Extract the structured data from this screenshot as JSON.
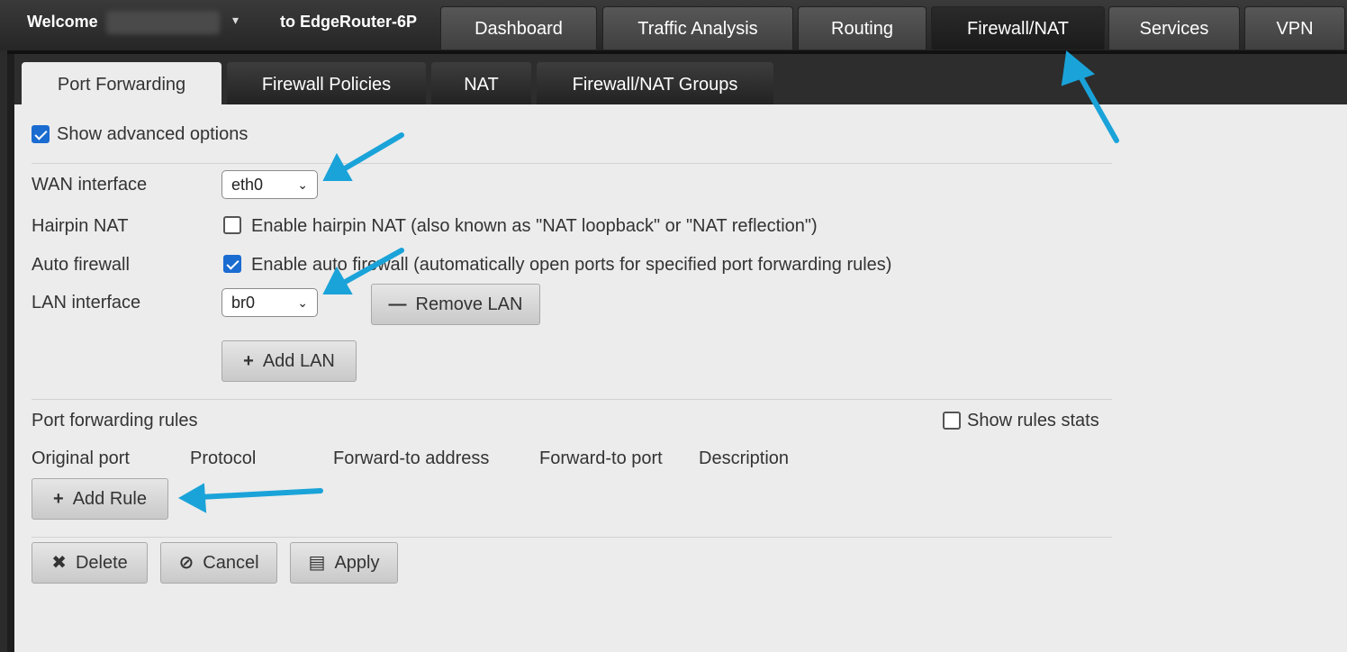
{
  "topbar": {
    "welcome": "Welcome",
    "caret": "▾",
    "router_name": "to EdgeRouter-6P",
    "tabs": [
      "Dashboard",
      "Traffic Analysis",
      "Routing",
      "Firewall/NAT",
      "Services",
      "VPN"
    ],
    "active_tab": "Firewall/NAT"
  },
  "subtabs": {
    "items": [
      "Port Forwarding",
      "Firewall Policies",
      "NAT",
      "Firewall/NAT Groups"
    ],
    "active": "Port Forwarding"
  },
  "form": {
    "show_advanced": {
      "label": "Show advanced options",
      "checked": true
    },
    "wan": {
      "label": "WAN interface",
      "value": "eth0"
    },
    "hairpin": {
      "label": "Hairpin NAT",
      "checkbox_label": "Enable hairpin NAT (also known as \"NAT loopback\" or \"NAT reflection\")",
      "checked": false
    },
    "auto_firewall": {
      "label": "Auto firewall",
      "checkbox_label": "Enable auto firewall (automatically open ports for specified port forwarding rules)",
      "checked": true
    },
    "lan": {
      "label": "LAN interface",
      "value": "br0"
    },
    "remove_lan": "Remove LAN",
    "add_lan": "Add LAN"
  },
  "rules": {
    "title": "Port forwarding rules",
    "show_stats": {
      "label": "Show rules stats",
      "checked": false
    },
    "columns": [
      "Original port",
      "Protocol",
      "Forward-to address",
      "Forward-to port",
      "Description"
    ],
    "add_rule": "Add Rule"
  },
  "actions": {
    "delete": "Delete",
    "cancel": "Cancel",
    "apply": "Apply"
  },
  "icons": {
    "chevron": "chevron-down-icon",
    "minus": "minus-icon",
    "plus": "plus-icon",
    "close": "close-icon",
    "cancel": "cancel-circle-icon",
    "save": "save-icon"
  },
  "colors": {
    "annotation_arrow": "#1aa3d9",
    "checkbox": "#1a6cd1"
  }
}
